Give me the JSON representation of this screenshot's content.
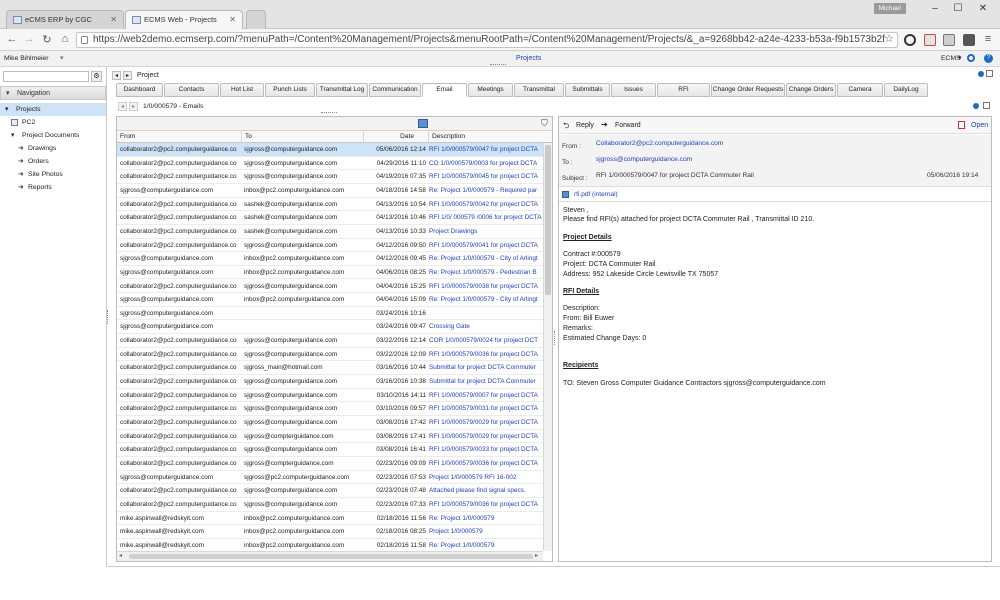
{
  "browser": {
    "tabs": [
      {
        "title": "eCMS ERP by CGC"
      },
      {
        "title": "ECMS Web - Projects"
      }
    ],
    "user_chip": "Michael",
    "url": "https://web2demo.ecmserp.com/?menuPath=/Content%20Management/Projects&menuRootPath=/Content%20Management/Projects/&_a=9268bb42-a24e-4233-b53a-f9b1573b2f"
  },
  "app": {
    "user_name": "Mike Bihlmeier",
    "module": "Projects",
    "ecms_menu": "ECMS"
  },
  "nav": {
    "header": "Navigation",
    "items": [
      {
        "label": "Projects",
        "level": 0
      },
      {
        "label": "PC2",
        "level": 1
      },
      {
        "label": "Project Documents",
        "level": 1
      },
      {
        "label": "Drawings",
        "level": 2
      },
      {
        "label": "Orders",
        "level": 2
      },
      {
        "label": "Site Photos",
        "level": 2
      },
      {
        "label": "Reports",
        "level": 2
      }
    ]
  },
  "project_bar": {
    "title": "Project"
  },
  "tabs": [
    "Dashboard",
    "Contacts",
    "Hot List",
    "Punch Lists",
    "Transmittal Log",
    "Communication",
    "Email",
    "Meetings",
    "Transmittal",
    "Submittals",
    "Issues",
    "RFI",
    "Change Order Requests",
    "Change Orders",
    "Camera",
    "DailyLog"
  ],
  "active_tab": "Email",
  "sub_bar": {
    "title": "1/0/000579 - Emails"
  },
  "grid": {
    "columns": {
      "from": "From",
      "to": "To",
      "date": "Date",
      "desc": "Description"
    },
    "rows": [
      {
        "from": "collaborator2@pc2.computerguidance.co",
        "to": "sjgross@computerguidance.com",
        "date": "05/06/2016 12:14",
        "desc": "RFI 1/0/000579/0047 for project DCTA"
      },
      {
        "from": "collaborator2@pc2.computerguidance.co",
        "to": "sjgross@computerguidance.com",
        "date": "04/29/2016 11:10",
        "desc": "CO 1/0/000579/0003 for project DCTA"
      },
      {
        "from": "collaborator2@pc2.computerguidance.co",
        "to": "sjgross@computerguidance.com",
        "date": "04/19/2016 07:35",
        "desc": "RFI 1/0/000579/0045 for project DCTA"
      },
      {
        "from": "sjgross@computerguidance.com",
        "to": "inbox@pc2.computerguidance.com",
        "date": "04/18/2016 14:58",
        "desc": "Re: Project 1/0/000579 - Required par"
      },
      {
        "from": "collaborator2@pc2.computerguidance.co",
        "to": "sashek@computerguidance.com",
        "date": "04/13/2016 10:54",
        "desc": "RFI 1/0/000579/0042 for project DCTA"
      },
      {
        "from": "collaborator2@pc2.computerguidance.co",
        "to": "sashek@computerguidance.com",
        "date": "04/13/2016 10:46",
        "desc": "RFI 1/0/ 000579 /0006 for project DCTA"
      },
      {
        "from": "collaborator2@pc2.computerguidance.co",
        "to": "sashek@computerguidance.com",
        "date": "04/13/2016 10:33",
        "desc": "Project Drawings"
      },
      {
        "from": "collaborator2@pc2.computerguidance.co",
        "to": "sjgross@computerguidance.com",
        "date": "04/12/2016 09:50",
        "desc": "RFI 1/0/000579/0041 for project DCTA"
      },
      {
        "from": "sjgross@computerguidance.com",
        "to": "inbox@pc2.computerguidance.com",
        "date": "04/12/2016 09:45",
        "desc": "Re: Project 1/0/000579 - City of Arlingt"
      },
      {
        "from": "sjgross@computerguidance.com",
        "to": "inbox@pc2.computerguidance.com",
        "date": "04/06/2016 08:25",
        "desc": "Re: Project 1/0/000579 - Pedestrian B"
      },
      {
        "from": "collaborator2@pc2.computerguidance.co",
        "to": "sjgross@computerguidance.com",
        "date": "04/04/2016 15:25",
        "desc": "RFI 1/0/000579/0038 for project DCTA"
      },
      {
        "from": "sjgross@computerguidance.com",
        "to": "inbox@pc2.computerguidance.com",
        "date": "04/04/2016 15:09",
        "desc": "Re: Project 1/0/000579 - City of Arlingt"
      },
      {
        "from": "sjgross@computerguidance.com",
        "to": "",
        "date": "03/24/2016 10:16",
        "desc": ""
      },
      {
        "from": "sjgross@computerguidance.com",
        "to": "",
        "date": "03/24/2016 09:47",
        "desc": "Crossing Gate"
      },
      {
        "from": "collaborator2@pc2.computerguidance.co",
        "to": "sjgross@computerguidance.com",
        "date": "03/22/2016 12:14",
        "desc": "COR 1/0/000579/0024 for project DCT"
      },
      {
        "from": "collaborator2@pc2.computerguidance.co",
        "to": "sjgross@computerguidance.com",
        "date": "03/22/2016 12:09",
        "desc": "RFI 1/0/000579/0036 for project DCTA"
      },
      {
        "from": "collaborator2@pc2.computerguidance.co",
        "to": "sjgross_main@hotmail.com",
        "date": "03/16/2016 10:44",
        "desc": "Submittal for project DCTA Commuter"
      },
      {
        "from": "collaborator2@pc2.computerguidance.co",
        "to": "sjgross@computerguidance.com",
        "date": "03/16/2016 10:38",
        "desc": "Submittal for project DCTA Commuter"
      },
      {
        "from": "collaborator2@pc2.computerguidance.co",
        "to": "sjgross@computerguidance.com",
        "date": "03/10/2016 14:11",
        "desc": "RFI 1/0/000579/0007 for project DCTA"
      },
      {
        "from": "collaborator2@pc2.computerguidance.co",
        "to": "sjgross@computerguidance.com",
        "date": "03/10/2016 09:57",
        "desc": "RFI 1/0/000579/0031 for project DCTA"
      },
      {
        "from": "collaborator2@pc2.computerguidance.co",
        "to": "sjgross@computerguidance.com",
        "date": "03/08/2016 17:42",
        "desc": "RFI 1/0/000579/0029 for project DCTA"
      },
      {
        "from": "collaborator2@pc2.computerguidance.co",
        "to": "sjgross@compterguidance.com",
        "date": "03/08/2016 17:41",
        "desc": "RFI 1/0/000579/0029 for project DCTA"
      },
      {
        "from": "collaborator2@pc2.computerguidance.co",
        "to": "sjgross@computerguidance.com",
        "date": "03/08/2016 16:41",
        "desc": "RFI 1/0/000579/0033 for project DCTA"
      },
      {
        "from": "collaborator2@pc2.computerguidance.co",
        "to": "sjgross@compterguidance.com",
        "date": "02/23/2016 09:09",
        "desc": "RFI 1/0/000579/0036 for project DCTA"
      },
      {
        "from": "sjgross@computerguidance.com",
        "to": "sjgross@pc2.computerguidance.com",
        "date": "02/23/2016 07:53",
        "desc": "Project 1/0/000579  RFI 16-002"
      },
      {
        "from": "collaborator2@pc2.computerguidance.co",
        "to": "sjgross@computerguidance.com",
        "date": "02/23/2016 07:48",
        "desc": "Attached please find signal specs."
      },
      {
        "from": "collaborator2@pc2.computerguidance.co",
        "to": "sjgross@computerguidance.com",
        "date": "02/23/2016 07:33",
        "desc": "RFI 1/0/000579/0036 for project DCTA"
      },
      {
        "from": "mike.aspinwall@redskyit.com",
        "to": "inbox@pc2.computerguidance.com",
        "date": "02/18/2016 11:56",
        "desc": "Re: Project 1/0/000579"
      },
      {
        "from": "mike.aspinwall@redskyit.com",
        "to": "inbox@pc2.computerguidance.com",
        "date": "02/18/2016 08:25",
        "desc": "Project 1/0/000579"
      },
      {
        "from": "mike.aspinwall@redskyit.com",
        "to": "inbox@pc2.computerguidance.com",
        "date": "02/18/2016 11:58",
        "desc": "Re: Project 1/0/000579"
      }
    ]
  },
  "detail": {
    "reply": "Reply",
    "forward": "Forward",
    "open": "Open",
    "from_label": "From :",
    "from": "Collaborator2@pc2.computerguidance.com",
    "to_label": "To :",
    "to": "sjgross@computerguidance.com",
    "subject_label": "Subject :",
    "subject": "RFI 1/0/000579/0047 for project DCTA Commuter Rail",
    "date": "05/06/2016 19:14",
    "attachment": "rfi.pdf (internal)",
    "body": [
      "Steven ,",
      "Please find RFI(s) attached for project DCTA Commuter Rail , Transmittal ID 210."
    ],
    "project_details_head": "Project Details",
    "project_details": [
      "Contract #:000579",
      "Project: DCTA Commuter Rail",
      "Address: 952 Lakeside Circle Lewisville TX 75057"
    ],
    "rfi_head": "RFI Details",
    "rfi_details": [
      "Description:",
      "From: Bill Euwer",
      "Remarks:",
      "Estimated Change Days: 0"
    ],
    "recipients_head": "Recipients",
    "recipients": "TO: Steven Gross Computer Guidance Contractors sjgross@computerguidance.com"
  }
}
